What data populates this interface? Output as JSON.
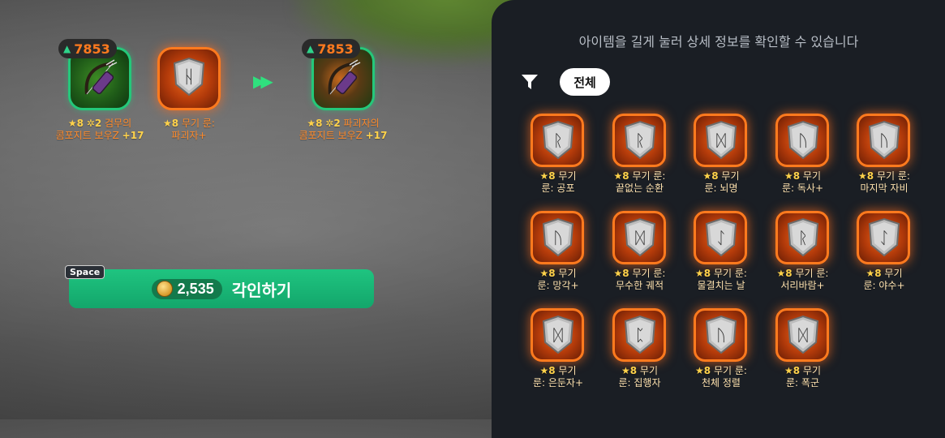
{
  "colors": {
    "accent_green": "#1fc480",
    "orange": "#ff7a1e",
    "panel_bg": "#1a1e24"
  },
  "preview": {
    "current": {
      "power": "7853",
      "stars": "★8",
      "plus": "✲2",
      "name_line1": "검무의",
      "name_line2": "콤포지트 보우Z",
      "enhance": "+17",
      "icon": "bow-icon"
    },
    "material": {
      "stars": "★8",
      "name_line1": "무기 룬:",
      "name_line2": "파괴자+",
      "rune_glyph": "ᚺ",
      "icon": "rune-icon"
    },
    "arrow_icon": "fast-forward-icon",
    "result": {
      "power": "7853",
      "stars": "★8",
      "plus": "✲2",
      "name_line1": "파괴자의",
      "name_line2": "콤포지트 보우Z",
      "enhance": "+17",
      "icon": "bow-icon"
    }
  },
  "action": {
    "hotkey": "Space",
    "cost": "2,535",
    "label": "각인하기"
  },
  "panel": {
    "hint": "아이템을 길게 눌러 상세 정보를 확인할 수 있습니다",
    "filter_icon": "filter-icon",
    "chip_all": "전체",
    "runes": [
      {
        "stars": "★8",
        "line1": "무기",
        "line2": "룬: 공포",
        "glyph": "ᚱ"
      },
      {
        "stars": "★8",
        "line1": "무기 룬:",
        "line2": "끝없는 순환",
        "glyph": "ᚱ"
      },
      {
        "stars": "★8",
        "line1": "무기",
        "line2": "룬: 뇌명",
        "glyph": "ᛞ"
      },
      {
        "stars": "★8",
        "line1": "무기",
        "line2": "룬: 독사+",
        "glyph": "ᚢ"
      },
      {
        "stars": "★8",
        "line1": "무기 룬:",
        "line2": "마지막 자비",
        "glyph": "ᚢ"
      },
      {
        "stars": "★8",
        "line1": "무기",
        "line2": "룬: 망각+",
        "glyph": "ᚢ"
      },
      {
        "stars": "★8",
        "line1": "무기 룬:",
        "line2": "무수한 궤적",
        "glyph": "ᛞ"
      },
      {
        "stars": "★8",
        "line1": "무기 룬:",
        "line2": "물결치는 날",
        "glyph": "ᛇ"
      },
      {
        "stars": "★8",
        "line1": "무기 룬:",
        "line2": "서리바람+",
        "glyph": "ᚱ"
      },
      {
        "stars": "★8",
        "line1": "무기",
        "line2": "룬: 야수+",
        "glyph": "ᛇ"
      },
      {
        "stars": "★8",
        "line1": "무기",
        "line2": "룬: 은둔자+",
        "glyph": "ᛞ"
      },
      {
        "stars": "★8",
        "line1": "무기",
        "line2": "룬: 집행자",
        "glyph": "ᛈ"
      },
      {
        "stars": "★8",
        "line1": "무기 룬:",
        "line2": "천체 정렬",
        "glyph": "ᚢ"
      },
      {
        "stars": "★8",
        "line1": "무기",
        "line2": "룬: 폭군",
        "glyph": "ᛞ"
      }
    ]
  }
}
